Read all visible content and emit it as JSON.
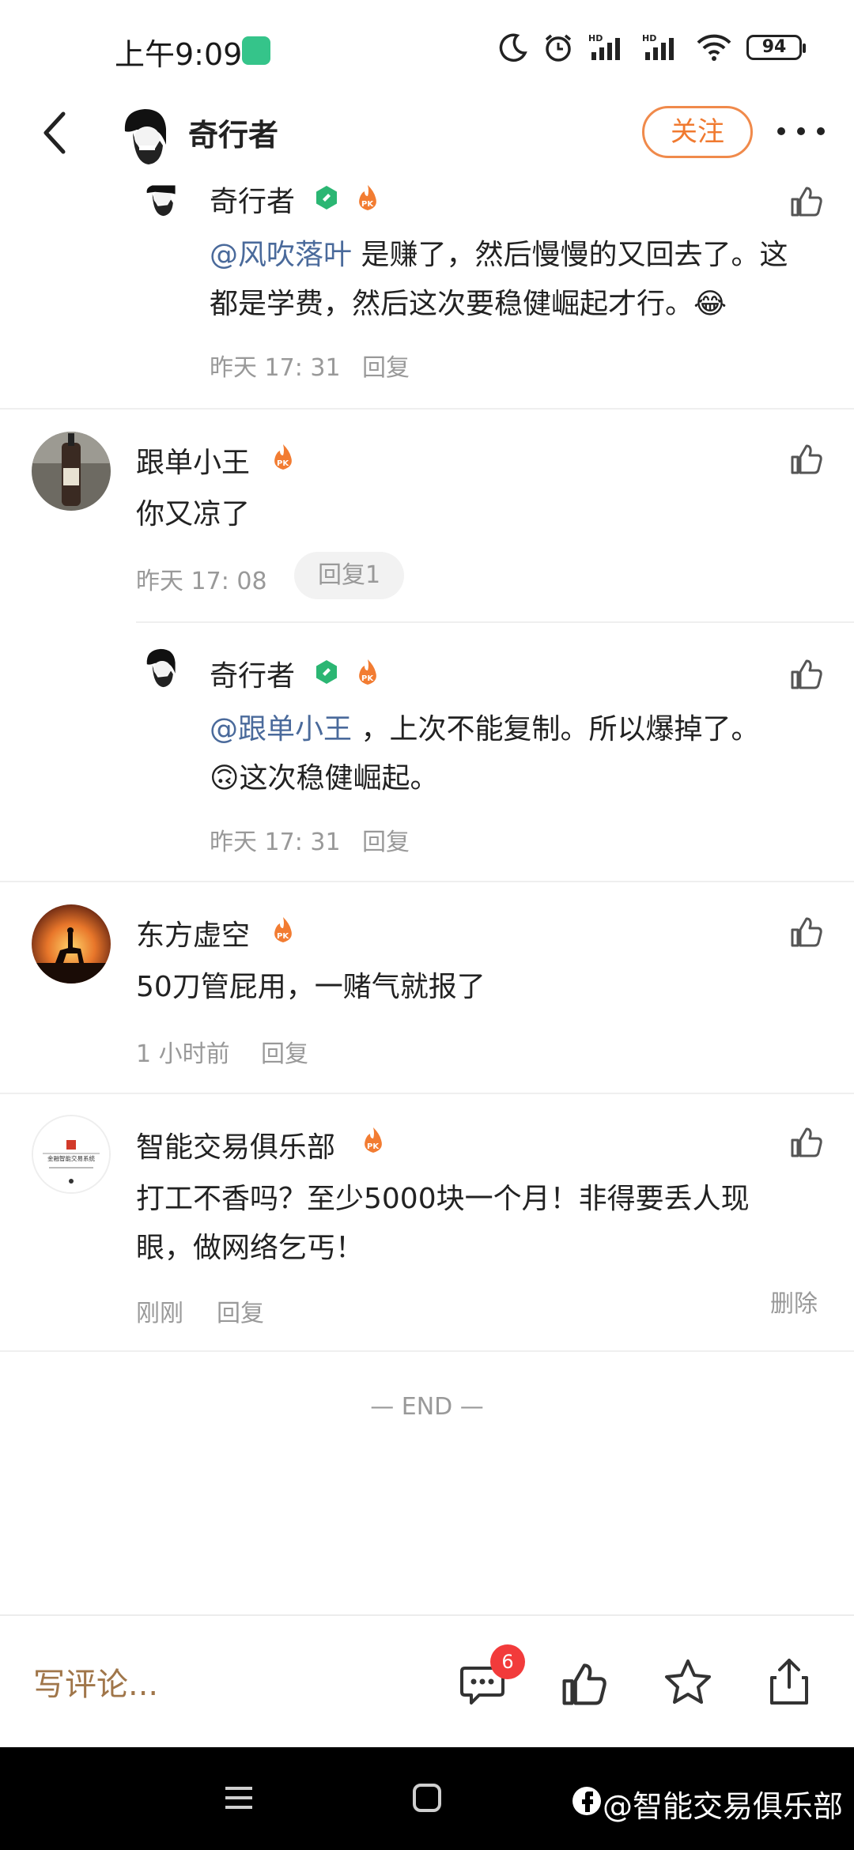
{
  "status_bar": {
    "time": "上午9:09",
    "battery": "94"
  },
  "header": {
    "author": "奇行者",
    "follow_label": "关注"
  },
  "comments": [
    {
      "author": "奇行者",
      "mention": "@风吹落叶",
      "text_line1": " 是赚了，然后慢慢的又回去了。这",
      "text_line2": "都是学费，然后这次要稳健崛起才行。😂",
      "time": "昨天 17: 31",
      "reply_label": "回复"
    },
    {
      "author": "跟单小王",
      "text": "你又凉了",
      "time": "昨天 17: 08",
      "reply_label": "回复1"
    },
    {
      "author": "奇行者",
      "mention": "@跟单小王",
      "text_line1": " ，上次不能复制。所以爆掉了。",
      "text_line2": "🙃这次稳健崛起。",
      "time": "昨天 17: 31",
      "reply_label": "回复"
    },
    {
      "author": "东方虚空",
      "text": "50刀管屁用，一赌气就报了",
      "time": "1 小时前",
      "reply_label": "回复"
    },
    {
      "author": "智能交易俱乐部",
      "text_line1": "打工不香吗？至少5000块一个月！非得要丢人现",
      "text_line2": "眼，做网络乞丐！",
      "time": "刚刚",
      "reply_label": "回复",
      "delete_label": "删除",
      "avatar_text": "金融智能交易系统"
    }
  ],
  "end_text": "— END —",
  "bottom_bar": {
    "write_placeholder": "写评论...",
    "comment_count": "6"
  },
  "watermark": "@智能交易俱乐部",
  "colors": {
    "accent_orange": "#f07a30",
    "mention_blue": "#4a6a9b",
    "badge_red": "#f23b3b",
    "verified_green": "#2bb673"
  }
}
